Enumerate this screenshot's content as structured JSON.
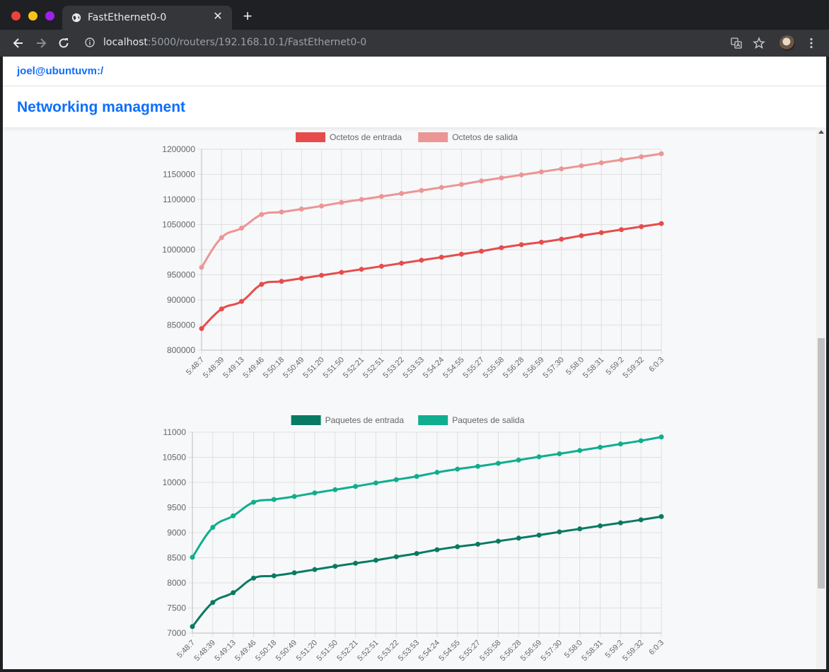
{
  "browser": {
    "tab_title": "FastEthernet0-0",
    "close_glyph": "✕",
    "new_tab_glyph": "+",
    "url_host": "localhost",
    "url_path": ":5000/routers/192.168.10.1/FastEthernet0-0",
    "icons": [
      "globe-icon",
      "back-arrow-icon",
      "forward-arrow-icon",
      "reload-icon",
      "info-icon",
      "translate-icon",
      "star-icon",
      "avatar",
      "kebab-menu-icon"
    ]
  },
  "page": {
    "user_prompt": "joel@ubuntuvm:/",
    "brand_title": "Networking managment"
  },
  "chart_data": [
    {
      "type": "line",
      "categories": [
        "5:48:7",
        "5:48:39",
        "5:49:13",
        "5:49:46",
        "5:50:18",
        "5:50:49",
        "5:51:20",
        "5:51:50",
        "5:52:21",
        "5:52:51",
        "5:53:22",
        "5:53:53",
        "5:54:24",
        "5:54:55",
        "5:55:27",
        "5:55:58",
        "5:56:28",
        "5:56:59",
        "5:57:30",
        "5:58:0",
        "5:58:31",
        "5:59:2",
        "5:59:32",
        "6:0:3"
      ],
      "series": [
        {
          "name": "Octetos de entrada",
          "color": "#e74c4c",
          "values": [
            843000,
            882000,
            897000,
            931000,
            937000,
            943000,
            949000,
            955000,
            961000,
            967000,
            973000,
            979000,
            985000,
            991000,
            997000,
            1004000,
            1010000,
            1015000,
            1021000,
            1028000,
            1034000,
            1040000,
            1046000,
            1052000
          ]
        },
        {
          "name": "Octetos de salida",
          "color": "#ec9595",
          "values": [
            965000,
            1024000,
            1043000,
            1070000,
            1075000,
            1081000,
            1087000,
            1094000,
            1100000,
            1106000,
            1112000,
            1118000,
            1124000,
            1130000,
            1137000,
            1143000,
            1149000,
            1155000,
            1161000,
            1167000,
            1173000,
            1179000,
            1185000,
            1191000
          ]
        }
      ],
      "ylim": [
        800000,
        1200000
      ],
      "yticks": [
        800000,
        850000,
        900000,
        950000,
        1000000,
        1050000,
        1100000,
        1150000,
        1200000
      ],
      "grid": true,
      "legend": "top-center"
    },
    {
      "type": "line",
      "categories": [
        "5:48:7",
        "5:48:39",
        "5:49:13",
        "5:49:46",
        "5:50:18",
        "5:50:49",
        "5:51:20",
        "5:51:50",
        "5:52:21",
        "5:52:51",
        "5:53:22",
        "5:53:53",
        "5:54:24",
        "5:54:55",
        "5:55:27",
        "5:55:58",
        "5:56:28",
        "5:56:59",
        "5:57:30",
        "5:58:0",
        "5:58:31",
        "5:59:2",
        "5:59:32",
        "6:0:3"
      ],
      "series": [
        {
          "name": "Paquetes de entrada",
          "color": "#087a63",
          "values": [
            7130,
            7610,
            7805,
            8095,
            8140,
            8200,
            8265,
            8330,
            8390,
            8450,
            8520,
            8585,
            8660,
            8720,
            8770,
            8830,
            8890,
            8950,
            9015,
            9075,
            9135,
            9195,
            9255,
            9320
          ]
        },
        {
          "name": "Paquetes de salida",
          "color": "#0fae8f",
          "values": [
            8510,
            9105,
            9335,
            9605,
            9660,
            9720,
            9790,
            9855,
            9920,
            9990,
            10055,
            10120,
            10200,
            10265,
            10320,
            10380,
            10445,
            10510,
            10570,
            10635,
            10700,
            10765,
            10830,
            10905
          ]
        }
      ],
      "ylim": [
        7000,
        11000
      ],
      "yticks": [
        7000,
        7500,
        8000,
        8500,
        9000,
        9500,
        10000,
        10500,
        11000
      ],
      "grid": true,
      "legend": "top-center"
    }
  ]
}
